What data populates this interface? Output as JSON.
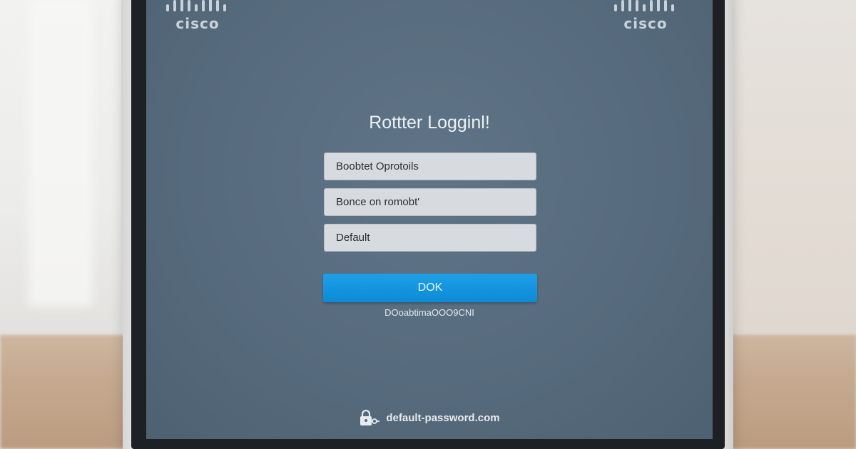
{
  "brand": {
    "name": "CISCO",
    "logo_color": "#c9d2da"
  },
  "login": {
    "title": "Rottter Logginl!",
    "fields": [
      {
        "value": "Boobtet Oprotoils"
      },
      {
        "value": "Bonce on romobt'"
      },
      {
        "value": "Default"
      }
    ],
    "button_label": "DOK",
    "helper_text": "DOoabtimaOOO9CNI",
    "button_color": "#1596e0"
  },
  "footer": {
    "text": "default-password.com",
    "icon": "lock-key-icon"
  },
  "colors": {
    "screen": "#586d7f",
    "field": "#d7dbdf"
  }
}
